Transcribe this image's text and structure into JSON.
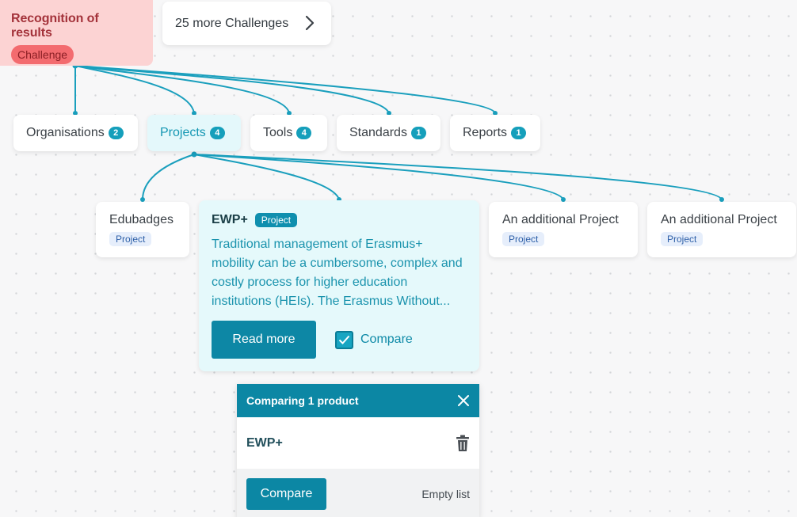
{
  "challenge": {
    "title": "Recognition of results",
    "badge": "Challenge"
  },
  "more_challenges": {
    "label": "25 more Challenges"
  },
  "categories": [
    {
      "label": "Organisations",
      "count": "2"
    },
    {
      "label": "Projects",
      "count": "4"
    },
    {
      "label": "Tools",
      "count": "4"
    },
    {
      "label": "Standards",
      "count": "1"
    },
    {
      "label": "Reports",
      "count": "1"
    }
  ],
  "projects": [
    {
      "title": "Edubadges",
      "tag": "Project"
    },
    {
      "title": "An additional Project",
      "tag": "Project"
    },
    {
      "title": "An additional Project",
      "tag": "Project"
    }
  ],
  "featured_project": {
    "title": "EWP+",
    "badge": "Project",
    "description": "Traditional management of Erasmus+ mobility can be a cumbersome, complex and costly process for higher education institutions (HEIs). The Erasmus Without...",
    "read_more_label": "Read more",
    "compare_label": "Compare",
    "compare_checked": true
  },
  "compare_panel": {
    "title": "Comparing 1 product",
    "items": [
      {
        "name": "EWP+"
      }
    ],
    "compare_button": "Compare",
    "empty_link": "Empty list"
  },
  "colors": {
    "accent": "#0c87a4",
    "link_line": "#1a9fbd",
    "challenge_bg": "#fcd3d3",
    "challenge_text": "#a3323a"
  }
}
